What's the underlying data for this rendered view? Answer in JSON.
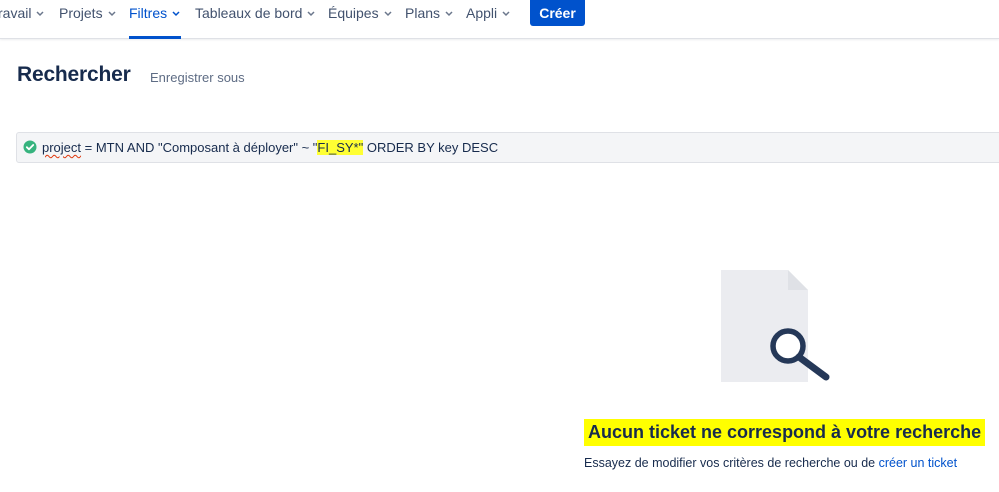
{
  "nav": {
    "items": [
      {
        "label": "ravail"
      },
      {
        "label": "Projets"
      },
      {
        "label": "Filtres",
        "active": true
      },
      {
        "label": "Tableaux de bord"
      },
      {
        "label": "Équipes"
      },
      {
        "label": "Plans"
      },
      {
        "label": "Appli"
      }
    ],
    "create_label": "Créer"
  },
  "header": {
    "title": "Rechercher",
    "save_as": "Enregistrer sous"
  },
  "jql": {
    "status_icon": "check-circle-icon",
    "part_squiggle": "project",
    "part_1": " = MTN AND \"Composant à déployer\" ~ \"",
    "part_highlight": "FI_SY*\"",
    "part_2": " ORDER BY key DESC"
  },
  "empty_state": {
    "icon": "document-search-icon",
    "title": "Aucun ticket ne correspond à votre recherche",
    "description": "Essayez de modifier vos critères de recherche ou de ",
    "link": "créer un ticket"
  },
  "colors": {
    "brand": "#0052cc",
    "highlight": "#ffff00",
    "success": "#36b37e"
  }
}
